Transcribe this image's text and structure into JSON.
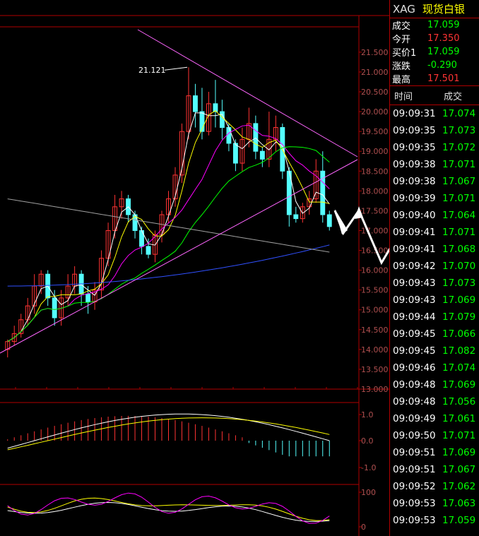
{
  "colors": {
    "up": "#ff3333",
    "down": "#54ffff",
    "grid": "#b00000",
    "axis": "#b00000",
    "label": "#b05050",
    "green": "#00ff00",
    "yellow": "#ffff00",
    "white": "#ffffff"
  },
  "header": {
    "symbol": "XAG",
    "name": "现货白银"
  },
  "quote": [
    {
      "label": "成交",
      "value": "17.059",
      "color": "#00ff00"
    },
    {
      "label": "今开",
      "value": "17.350",
      "color": "#ff3333"
    },
    {
      "label": "买价1",
      "value": "17.059",
      "color": "#00ff00"
    },
    {
      "label": "涨跌",
      "value": "-0.290",
      "color": "#00ff00"
    },
    {
      "label": "最高",
      "value": "17.501",
      "color": "#ff3333"
    }
  ],
  "ticks": {
    "header": {
      "time": "时间",
      "price": "成交"
    },
    "rows": [
      [
        "09:09:31",
        "17.074"
      ],
      [
        "09:09:35",
        "17.073"
      ],
      [
        "09:09:35",
        "17.072"
      ],
      [
        "09:09:38",
        "17.071"
      ],
      [
        "09:09:38",
        "17.067"
      ],
      [
        "09:09:39",
        "17.071"
      ],
      [
        "09:09:40",
        "17.064"
      ],
      [
        "09:09:41",
        "17.071"
      ],
      [
        "09:09:41",
        "17.068"
      ],
      [
        "09:09:42",
        "17.070"
      ],
      [
        "09:09:43",
        "17.073"
      ],
      [
        "09:09:43",
        "17.069"
      ],
      [
        "09:09:44",
        "17.079"
      ],
      [
        "09:09:45",
        "17.066"
      ],
      [
        "09:09:45",
        "17.082"
      ],
      [
        "09:09:46",
        "17.074"
      ],
      [
        "09:09:48",
        "17.069"
      ],
      [
        "09:09:48",
        "17.056"
      ],
      [
        "09:09:49",
        "17.061"
      ],
      [
        "09:09:50",
        "17.071"
      ],
      [
        "09:09:51",
        "17.069"
      ],
      [
        "09:09:51",
        "17.067"
      ],
      [
        "09:09:52",
        "17.062"
      ],
      [
        "09:09:53",
        "17.063"
      ],
      [
        "09:09:53",
        "17.059"
      ]
    ]
  },
  "chart_data": [
    {
      "type": "candlestick",
      "annotation": {
        "text": "21.121"
      },
      "ylim": [
        13,
        22
      ],
      "y_ticks": [
        "13.000",
        "13.500",
        "14.000",
        "14.500",
        "15.000",
        "15.500",
        "16.000",
        "16.500",
        "17.000",
        "17.500",
        "18.000",
        "18.500",
        "19.000",
        "19.500",
        "20.000",
        "20.500",
        "21.000",
        "21.500"
      ],
      "candles": [
        [
          14.0,
          14.2,
          13.8,
          14.25
        ],
        [
          14.2,
          14.4,
          14.1,
          14.6
        ],
        [
          14.4,
          14.75,
          14.3,
          14.9
        ],
        [
          14.75,
          15.1,
          14.6,
          15.3
        ],
        [
          15.1,
          15.6,
          14.9,
          15.9
        ],
        [
          15.6,
          15.9,
          15.4,
          16.0
        ],
        [
          15.9,
          15.3,
          15.1,
          16.0
        ],
        [
          15.3,
          14.8,
          14.6,
          15.5
        ],
        [
          14.8,
          15.3,
          14.6,
          15.5
        ],
        [
          15.3,
          15.6,
          15.1,
          15.9
        ],
        [
          15.6,
          15.9,
          15.4,
          16.1
        ],
        [
          15.9,
          15.4,
          15.1,
          16.0
        ],
        [
          15.4,
          15.2,
          14.9,
          15.6
        ],
        [
          15.2,
          15.5,
          15.0,
          15.7
        ],
        [
          15.5,
          16.3,
          15.3,
          16.5
        ],
        [
          16.3,
          17.0,
          16.1,
          17.2
        ],
        [
          17.0,
          17.6,
          16.8,
          17.9
        ],
        [
          17.6,
          17.8,
          17.3,
          18.0
        ],
        [
          17.8,
          17.4,
          17.2,
          17.9
        ],
        [
          17.4,
          17.0,
          16.8,
          17.5
        ],
        [
          17.0,
          16.6,
          16.4,
          17.1
        ],
        [
          16.6,
          16.4,
          16.3,
          16.8
        ],
        [
          16.4,
          16.9,
          16.2,
          17.0
        ],
        [
          16.9,
          17.4,
          16.7,
          17.5
        ],
        [
          17.4,
          17.8,
          17.2,
          18.0
        ],
        [
          17.8,
          18.4,
          17.6,
          18.6
        ],
        [
          18.4,
          19.5,
          18.2,
          19.7
        ],
        [
          19.5,
          20.4,
          19.3,
          21.12
        ],
        [
          20.4,
          20.0,
          19.6,
          20.7
        ],
        [
          20.0,
          19.5,
          19.3,
          20.6
        ],
        [
          19.5,
          20.2,
          19.4,
          20.5
        ],
        [
          20.2,
          20.0,
          19.6,
          20.8
        ],
        [
          20.0,
          19.6,
          19.3,
          20.3
        ],
        [
          19.6,
          19.2,
          19.0,
          19.7
        ],
        [
          19.2,
          18.7,
          18.5,
          19.3
        ],
        [
          18.7,
          19.3,
          18.5,
          19.6
        ],
        [
          19.3,
          19.7,
          19.1,
          20.1
        ],
        [
          19.7,
          19.0,
          18.8,
          19.9
        ],
        [
          19.0,
          18.8,
          18.6,
          19.1
        ],
        [
          18.8,
          19.3,
          18.6,
          20.0
        ],
        [
          19.3,
          19.6,
          19.0,
          19.9
        ],
        [
          19.6,
          18.5,
          18.3,
          19.7
        ],
        [
          18.5,
          17.4,
          17.1,
          18.6
        ],
        [
          17.4,
          17.3,
          17.2,
          17.6
        ],
        [
          17.3,
          17.6,
          17.2,
          17.7
        ],
        [
          17.6,
          17.8,
          17.4,
          18.0
        ],
        [
          17.8,
          18.5,
          17.7,
          18.8
        ],
        [
          18.5,
          17.4,
          17.2,
          19.0
        ],
        [
          17.4,
          17.1,
          17.0,
          17.5
        ]
      ]
    },
    {
      "type": "bar",
      "y_ticks": [
        "1.0",
        "0.0",
        "-1.0"
      ],
      "ylim": [
        -1,
        1
      ]
    },
    {
      "type": "line",
      "y_ticks": [
        "100",
        "0"
      ],
      "ylim": [
        0,
        100
      ]
    }
  ]
}
